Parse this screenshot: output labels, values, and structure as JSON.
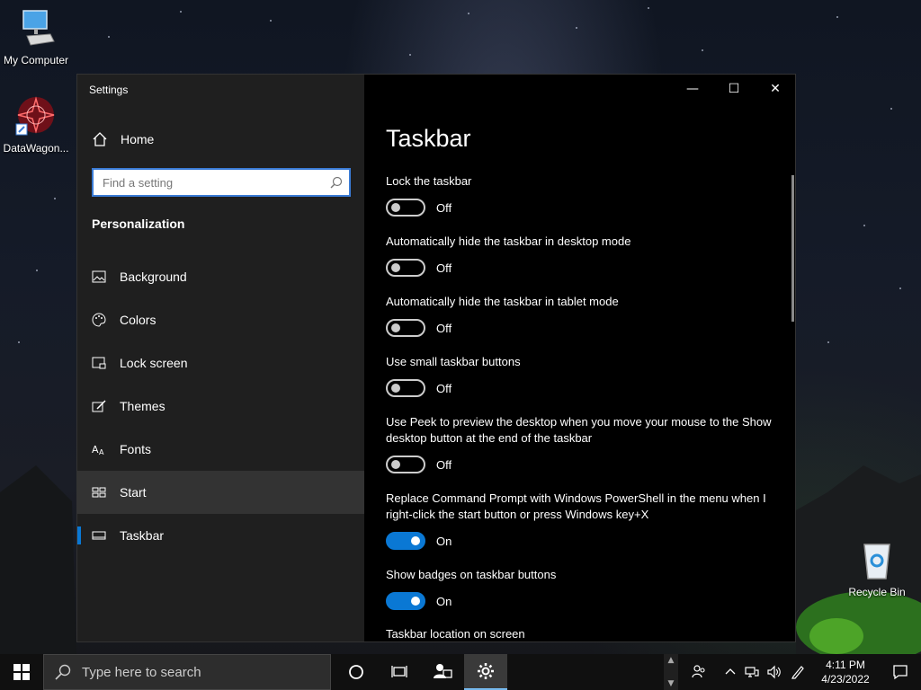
{
  "desktop": {
    "icons": [
      {
        "label": "My Computer"
      },
      {
        "label": "DataWagon..."
      },
      {
        "label": "Recycle Bin"
      }
    ]
  },
  "window": {
    "title": "Settings",
    "home_label": "Home",
    "search_placeholder": "Find a setting",
    "section_title": "Personalization",
    "nav": [
      {
        "label": "Background",
        "icon": "image-icon"
      },
      {
        "label": "Colors",
        "icon": "palette-icon"
      },
      {
        "label": "Lock screen",
        "icon": "lock-screen-icon"
      },
      {
        "label": "Themes",
        "icon": "brush-icon"
      },
      {
        "label": "Fonts",
        "icon": "font-icon"
      },
      {
        "label": "Start",
        "icon": "start-tiles-icon"
      },
      {
        "label": "Taskbar",
        "icon": "taskbar-icon"
      }
    ],
    "controls": {
      "minimize": "—",
      "maximize": "☐",
      "close": "✕"
    }
  },
  "content": {
    "title": "Taskbar",
    "options": [
      {
        "label": "Lock the taskbar",
        "state": "Off",
        "on": false
      },
      {
        "label": "Automatically hide the taskbar in desktop mode",
        "state": "Off",
        "on": false
      },
      {
        "label": "Automatically hide the taskbar in tablet mode",
        "state": "Off",
        "on": false
      },
      {
        "label": "Use small taskbar buttons",
        "state": "Off",
        "on": false
      },
      {
        "label": "Use Peek to preview the desktop when you move your mouse to the Show desktop button at the end of the taskbar",
        "state": "Off",
        "on": false
      },
      {
        "label": "Replace Command Prompt with Windows PowerShell in the menu when I right-click the start button or press Windows key+X",
        "state": "On",
        "on": true
      },
      {
        "label": "Show badges on taskbar buttons",
        "state": "On",
        "on": true
      }
    ],
    "location_label": "Taskbar location on screen"
  },
  "taskbar": {
    "search_text": "Type here to search",
    "time": "4:11 PM",
    "date": "4/23/2022"
  },
  "colors": {
    "accent": "#0a78d4",
    "sidebar_bg": "#1f1f1f",
    "content_bg": "#000000"
  }
}
